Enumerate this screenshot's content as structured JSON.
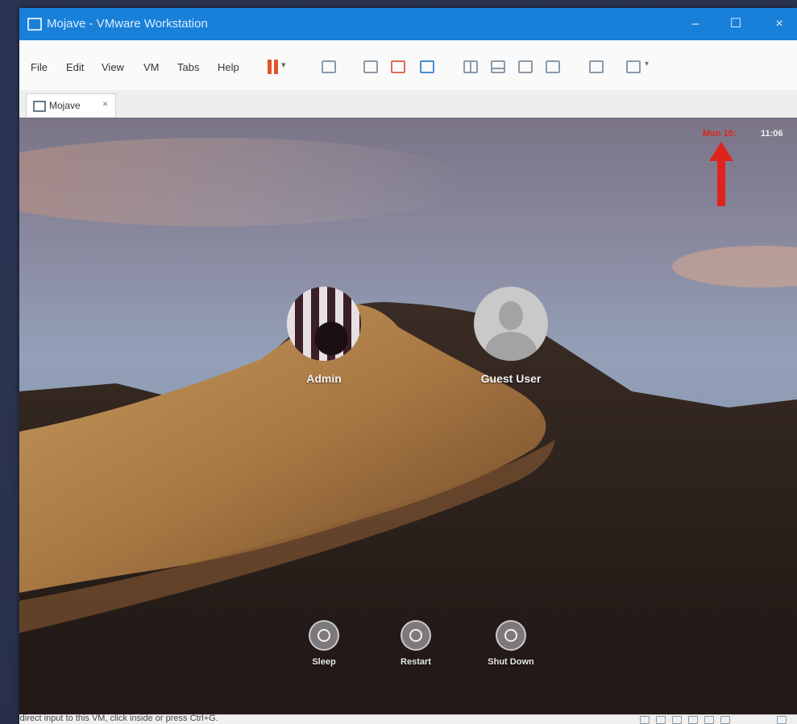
{
  "window": {
    "title": "Mojave - VMware Workstation",
    "controls": [
      "–",
      "☐",
      "×"
    ]
  },
  "menubar": {
    "items": [
      "File",
      "Edit",
      "View",
      "VM",
      "Tabs",
      "Help"
    ],
    "pause_dropdown": "▾",
    "tool_dropdown": "▾"
  },
  "tabs": [
    {
      "label": "Mojave",
      "close": "×"
    }
  ],
  "vm": {
    "clock_left": "Mon 10:",
    "clock_right": "11:06",
    "users": [
      {
        "name": "Admin",
        "avatar": "admin-avatar"
      },
      {
        "name": "Guest User",
        "avatar": "guest-silhouette"
      }
    ],
    "power_buttons": [
      {
        "label": "Sleep",
        "icon": "sleep-icon"
      },
      {
        "label": "Restart",
        "icon": "restart-icon"
      },
      {
        "label": "Shut Down",
        "icon": "power-icon"
      }
    ]
  },
  "statusbar": {
    "text": "To direct input to this VM, click inside or press Ctrl+G."
  },
  "colors": {
    "titlebar": "#1880d8",
    "accent_red": "#e0231c",
    "pause": "#e2542a"
  }
}
